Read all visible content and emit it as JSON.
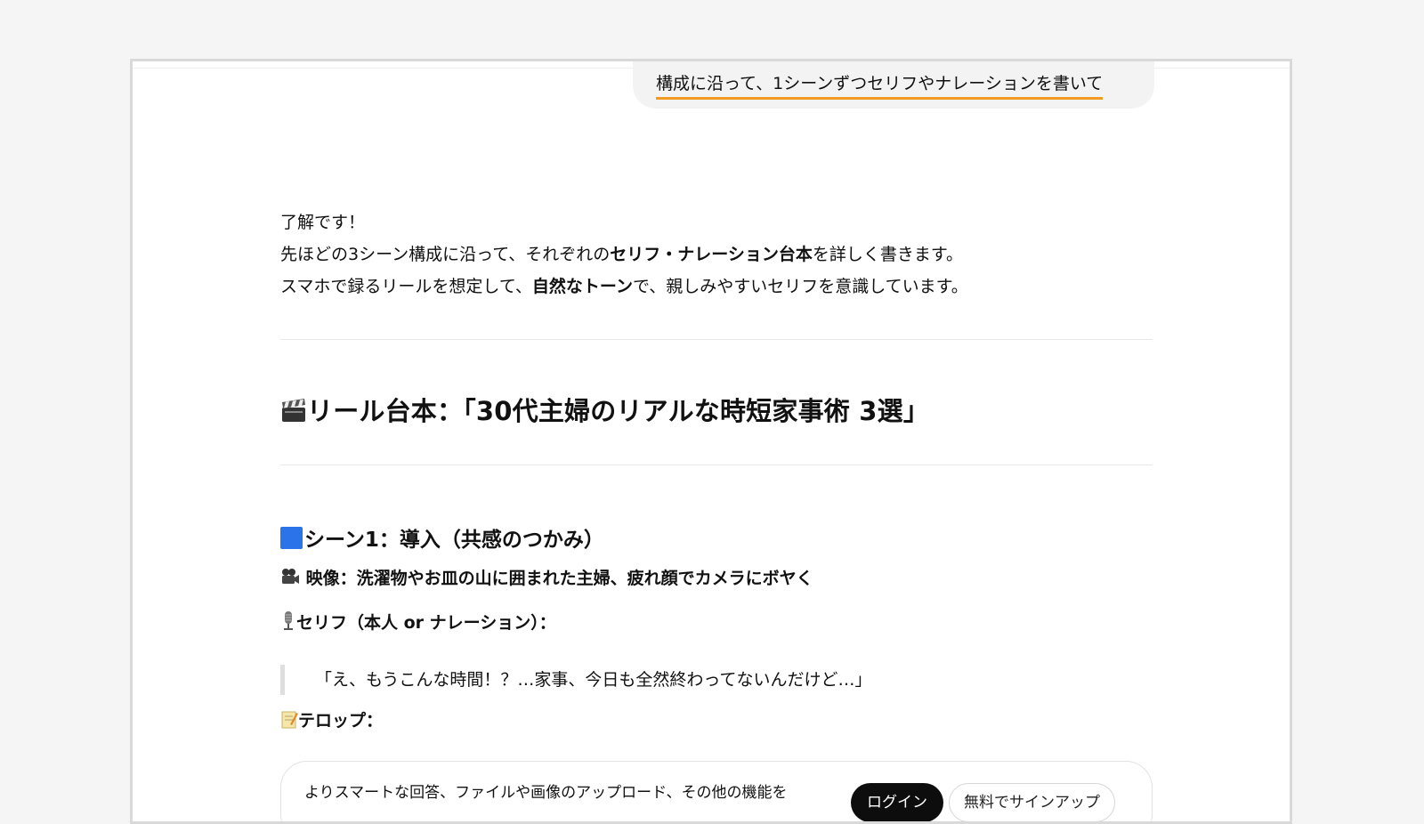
{
  "user_message": "構成に沿って、1シーンずつセリフやナレーションを書いて",
  "intro": {
    "line1": "了解です！",
    "line2_pre": "先ほどの3シーン構成に沿って、それぞれの",
    "line2_bold": "セリフ・ナレーション台本",
    "line2_post": "を詳しく書きます。",
    "line3_pre": "スマホで録るリールを想定して、",
    "line3_bold": "自然なトーン",
    "line3_post": "で、親しみやすいセリフを意識しています。"
  },
  "title": {
    "icon": "clapperboard-icon",
    "text": "リール台本：「30代主婦のリアルな時短家事術 3選」"
  },
  "scene1": {
    "heading_icon": "blue-square-icon",
    "heading": "シーン1：導入（共感のつかみ）",
    "video_icon": "movie-camera-icon",
    "video": "映像：洗濯物やお皿の山に囲まれた主婦、疲れ顔でカメラにボヤく",
    "line_icon": "microphone-icon",
    "line_label": "セリフ（本人 or ナレーション）：",
    "quote": "「え、もうこんな時間！？…家事、今日も全然終わってないんだけど…」",
    "caption_icon": "memo-icon",
    "caption_label": "テロップ："
  },
  "login_bar": {
    "message": "よりスマートな回答、ファイルや画像のアップロード、その他の機能を",
    "login_label": "ログイン",
    "signup_label": "無料でサインアップ"
  },
  "colors": {
    "accent_underline": "#f29a1f",
    "square": "#2a73e8"
  }
}
